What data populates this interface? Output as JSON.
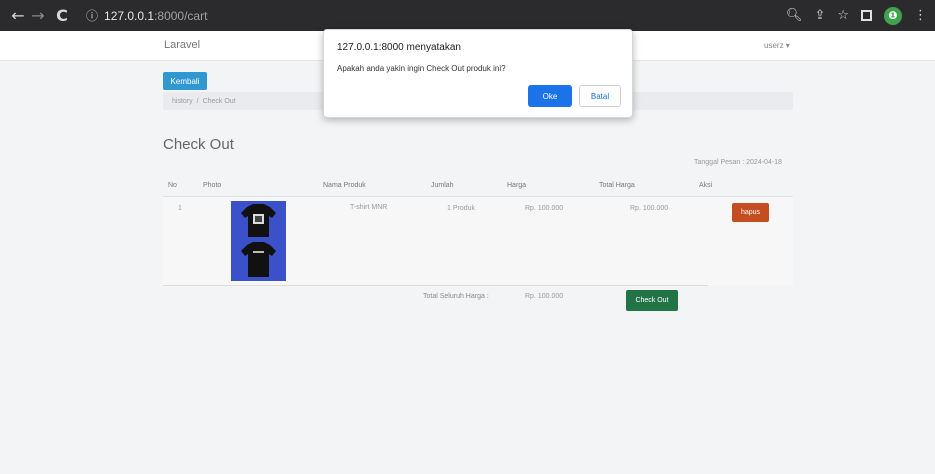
{
  "browser": {
    "url_host": "127.0.0.1",
    "url_path": ":8000/cart",
    "icons": [
      "back-icon",
      "forward-icon",
      "reload-icon",
      "info-icon",
      "zoom-icon",
      "share-icon",
      "star-icon",
      "window-icon",
      "extension-icon",
      "menu-icon"
    ]
  },
  "navbar": {
    "brand": "Laravel",
    "user": "userz ▾"
  },
  "page": {
    "back_button": "Kembali",
    "breadcrumb": [
      "history",
      "Check Out"
    ],
    "title": "Check Out",
    "order_date": "Tanggal Pesan : 2024-04-18"
  },
  "table": {
    "headers": [
      "No",
      "Photo",
      "Nama Produk",
      "Jumlah",
      "Harga",
      "Total Harga",
      "Aksi"
    ],
    "rows": [
      {
        "no": "1",
        "nama": "T-shirt MNR",
        "jumlah": "1 Produk",
        "harga": "Rp. 100.000",
        "total": "Rp. 100.000",
        "aksi": "hapus"
      }
    ],
    "grand_total_label": "Total Seluruh Harga :",
    "grand_total_value": "Rp. 100.000",
    "checkout_button": "Check Out"
  },
  "dialog": {
    "title": "127.0.0.1:8000 menyatakan",
    "message": "Apakah anda yakin ingin Check Out produk ini?",
    "ok": "Oke",
    "cancel": "Batal"
  },
  "colors": {
    "primary": "#3097d1",
    "danger": "#c44e1f",
    "success": "#227447",
    "dialog_ok": "#1a73e8"
  }
}
